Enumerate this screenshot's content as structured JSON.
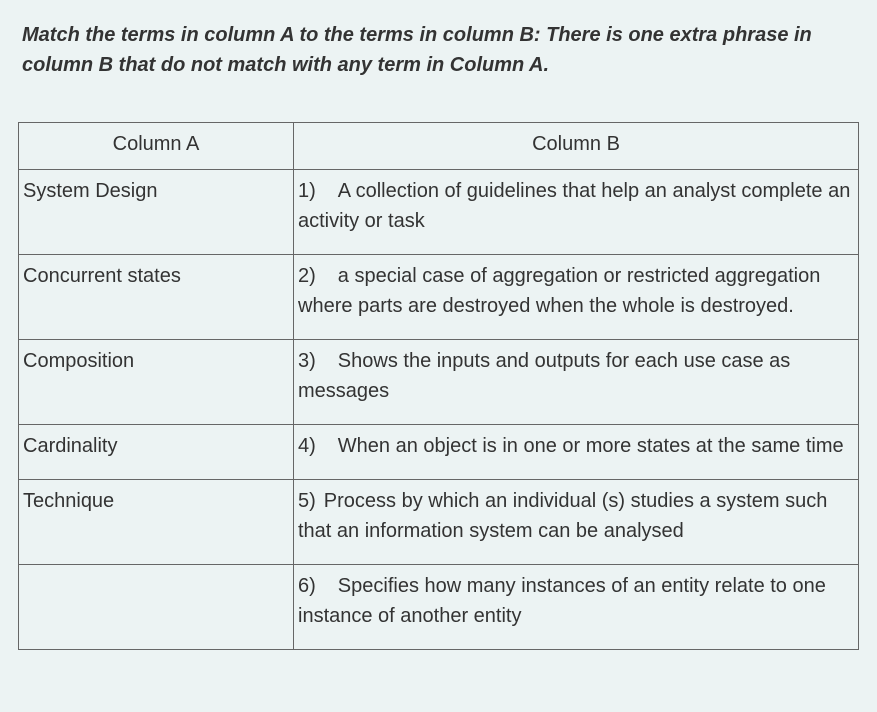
{
  "instructions": "Match the terms in column A to the terms in column B: There is one extra phrase in column B that do not match with any term in Column A.",
  "headers": {
    "colA": "Column A",
    "colB": "Column B"
  },
  "rows": [
    {
      "term": "System Design",
      "num": "1)",
      "desc": "A collection of guidelines that help an analyst complete an activity or task"
    },
    {
      "term": "Concurrent states",
      "num": "2)",
      "desc": "a special case of aggregation or restricted aggregation where parts are destroyed when the whole is destroyed."
    },
    {
      "term": "Composition",
      "num": "3)",
      "desc": "Shows the inputs and outputs for each use case as messages"
    },
    {
      "term": "Cardinality",
      "num": "4)",
      "desc": "When an object is in one or more states at the same time"
    },
    {
      "term": "Technique",
      "num": "5)",
      "desc": "Process by which an individual (s) studies a system such that an information system can be analysed"
    },
    {
      "term": "",
      "num": "6)",
      "desc": "Specifies how many instances of an entity relate to one instance of another entity"
    }
  ]
}
